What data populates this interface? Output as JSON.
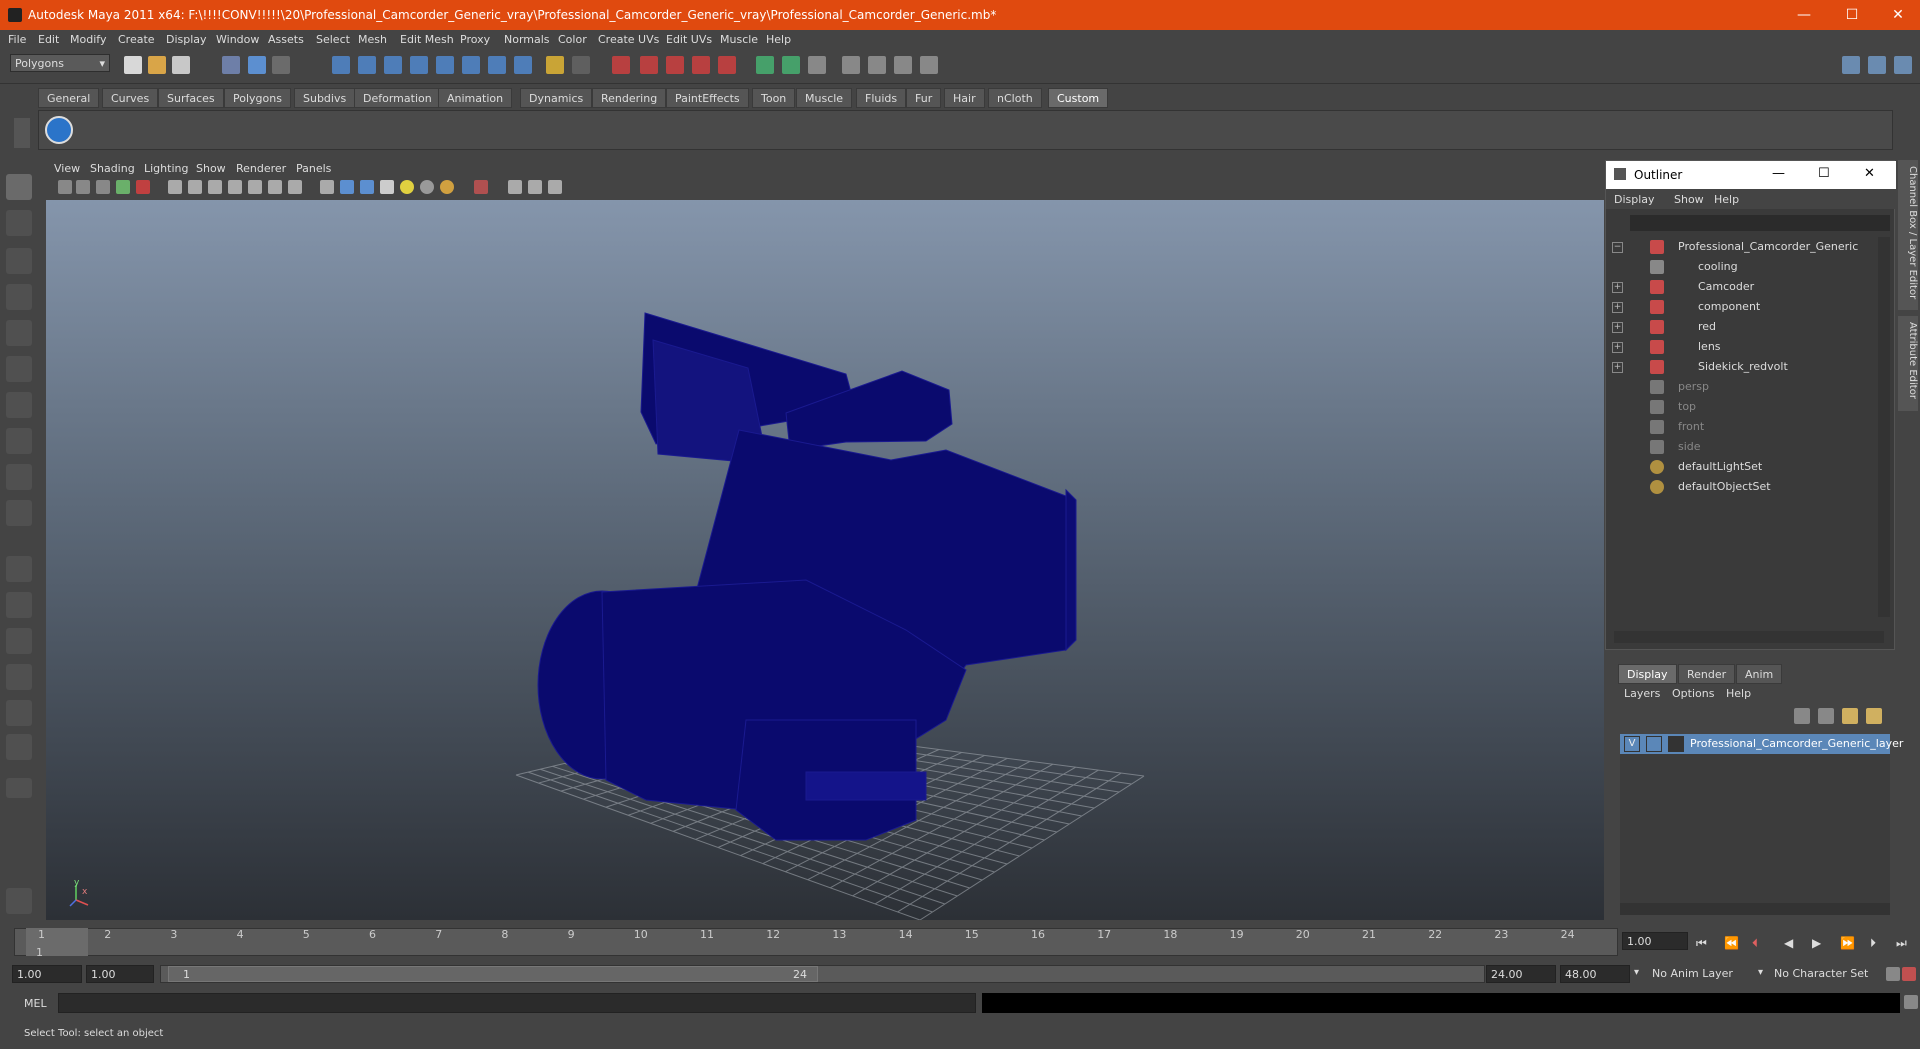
{
  "window": {
    "title": "Autodesk Maya 2011 x64: F:\\!!!!CONV!!!!!\\20\\Professional_Camcorder_Generic_vray\\Professional_Camcorder_Generic_vray\\Professional_Camcorder_Generic.mb*",
    "minimize": "—",
    "maximize": "☐",
    "close": "✕"
  },
  "menubar": [
    "File",
    "Edit",
    "Modify",
    "Create",
    "Display",
    "Window",
    "Assets",
    "Select",
    "Mesh",
    "Edit Mesh",
    "Proxy",
    "Normals",
    "Color",
    "Create UVs",
    "Edit UVs",
    "Muscle",
    "Help"
  ],
  "mode_dropdown": "Polygons",
  "shelf_tabs": [
    "General",
    "Curves",
    "Surfaces",
    "Polygons",
    "Subdivs",
    "Deformation",
    "Animation",
    "Dynamics",
    "Rendering",
    "PaintEffects",
    "Toon",
    "Muscle",
    "Fluids",
    "Fur",
    "Hair",
    "nCloth",
    "Custom"
  ],
  "active_shelf_tab": "Custom",
  "viewport_menu": [
    "View",
    "Shading",
    "Lighting",
    "Show",
    "Renderer",
    "Panels"
  ],
  "outliner": {
    "title": "Outliner",
    "menu": [
      "Display",
      "Show",
      "Help"
    ],
    "items": [
      {
        "label": "Professional_Camcorder_Generic",
        "expander": "−",
        "dim": false
      },
      {
        "label": "cooling",
        "expander": "",
        "dim": false
      },
      {
        "label": "Camcoder",
        "expander": "+",
        "dim": false
      },
      {
        "label": "component",
        "expander": "+",
        "dim": false
      },
      {
        "label": "red",
        "expander": "+",
        "dim": false
      },
      {
        "label": "lens",
        "expander": "+",
        "dim": false
      },
      {
        "label": "Sidekick_redvolt",
        "expander": "+",
        "dim": false
      },
      {
        "label": "persp",
        "expander": "",
        "dim": true
      },
      {
        "label": "top",
        "expander": "",
        "dim": true
      },
      {
        "label": "front",
        "expander": "",
        "dim": true
      },
      {
        "label": "side",
        "expander": "",
        "dim": true
      },
      {
        "label": "defaultLightSet",
        "expander": "",
        "dim": false
      },
      {
        "label": "defaultObjectSet",
        "expander": "",
        "dim": false
      }
    ]
  },
  "layer_editor": {
    "tabs": [
      "Display",
      "Render",
      "Anim"
    ],
    "menu": [
      "Layers",
      "Options",
      "Help"
    ],
    "layer": {
      "visible": "V",
      "name": "Professional_Camcorder_Generic_layer"
    }
  },
  "side_tabs": [
    "Channel Box / Layer Editor",
    "Attribute Editor"
  ],
  "timeline": {
    "ticks": [
      "1",
      "2",
      "3",
      "4",
      "5",
      "6",
      "7",
      "8",
      "9",
      "10",
      "11",
      "12",
      "13",
      "14",
      "15",
      "16",
      "17",
      "18",
      "19",
      "20",
      "21",
      "22",
      "23",
      "24"
    ],
    "current_frame_label": "1",
    "current_time": "1.00"
  },
  "range": {
    "start": "1.00",
    "playback_start": "1.00",
    "slider_start": "1",
    "slider_end": "24",
    "playback_end": "24.00",
    "end": "48.00",
    "anim_layer": "No Anim Layer",
    "character_set": "No Character Set"
  },
  "cmdline": {
    "label": "MEL"
  },
  "helpline": "Select Tool: select an object",
  "axis": {
    "x": "x",
    "y": "y"
  },
  "colors": {
    "titlebar": "#e04a0f",
    "wireframe": "#0a0a6e",
    "selected_layer": "#5b87b8"
  }
}
